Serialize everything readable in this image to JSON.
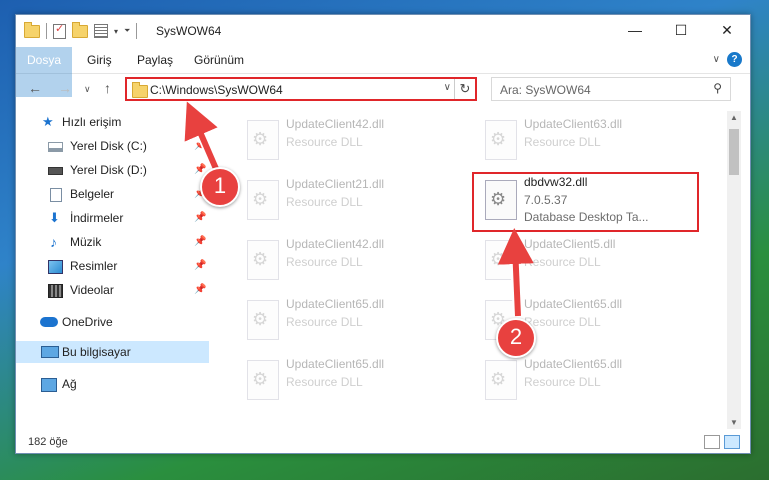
{
  "window": {
    "title": "SysWOW64",
    "buttons": {
      "minimize": "—",
      "maximize": "☐",
      "close": "✕"
    }
  },
  "ribbon": {
    "tabs": [
      "Dosya",
      "Giriş",
      "Paylaş",
      "Görünüm"
    ],
    "help": "?"
  },
  "address": {
    "path": "C:\\Windows\\SysWOW64",
    "search_placeholder": "Ara: SysWOW64"
  },
  "sidebar": {
    "items": [
      {
        "label": "Hızlı erişim",
        "icon": "star-icon"
      },
      {
        "label": "Yerel Disk (C:)",
        "icon": "drive-icon",
        "pinned": true
      },
      {
        "label": "Yerel Disk (D:)",
        "icon": "drive-icon",
        "pinned": true
      },
      {
        "label": "Belgeler",
        "icon": "document-icon",
        "pinned": true
      },
      {
        "label": "İndirmeler",
        "icon": "download-icon",
        "pinned": true
      },
      {
        "label": "Müzik",
        "icon": "music-icon",
        "pinned": true
      },
      {
        "label": "Resimler",
        "icon": "pictures-icon",
        "pinned": true
      },
      {
        "label": "Videolar",
        "icon": "video-icon",
        "pinned": true
      },
      {
        "label": "OneDrive",
        "icon": "cloud-icon"
      },
      {
        "label": "Bu bilgisayar",
        "icon": "computer-icon",
        "selected": true
      },
      {
        "label": "Ağ",
        "icon": "network-icon"
      }
    ]
  },
  "files": [
    {
      "name": "UpdateClient42.dll",
      "line2": "Resource DLL",
      "line3": ""
    },
    {
      "name": "UpdateClient63.dll",
      "line2": "Resource DLL",
      "line3": ""
    },
    {
      "name": "UpdateClient21.dll",
      "line2": "Resource DLL",
      "line3": ""
    },
    {
      "name": "dbdvw32.dll",
      "line2": "7.0.5.37",
      "line3": "Database Desktop Ta...",
      "highlighted": true
    },
    {
      "name": "UpdateClient42.dll",
      "line2": "Resource DLL",
      "line3": ""
    },
    {
      "name": "UpdateClient5.dll",
      "line2": "Resource DLL",
      "line3": ""
    },
    {
      "name": "UpdateClient65.dll",
      "line2": "Resource DLL",
      "line3": ""
    },
    {
      "name": "UpdateClient65.dll",
      "line2": "Resource DLL",
      "line3": ""
    },
    {
      "name": "UpdateClient65.dll",
      "line2": "Resource DLL",
      "line3": ""
    },
    {
      "name": "UpdateClient65.dll",
      "line2": "Resource DLL",
      "line3": ""
    }
  ],
  "status": {
    "count": "182 öğe"
  },
  "annotations": {
    "step1": "1",
    "step2": "2",
    "color": "#e0262a"
  }
}
